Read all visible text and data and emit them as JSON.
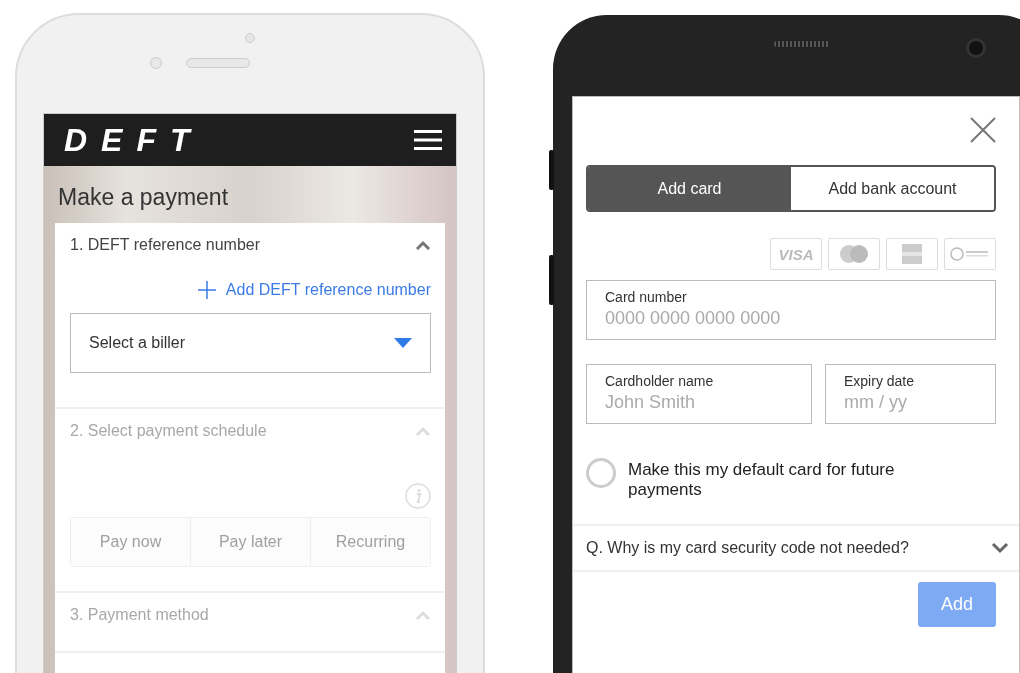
{
  "left_phone": {
    "app_bar": {
      "logo": "DEFT"
    },
    "title": "Make a payment",
    "sections": [
      {
        "kind": "biller",
        "heading": "1. DEFT reference number",
        "expanded": true,
        "disabled": false,
        "add_link": "Add DEFT reference number",
        "biller_select": {
          "label": "Select a biller"
        }
      },
      {
        "kind": "schedule",
        "heading": "2. Select payment schedule",
        "expanded": true,
        "disabled": true,
        "options": [
          {
            "label": "Pay now",
            "selected": false
          },
          {
            "label": "Pay later",
            "selected": false
          },
          {
            "label": "Recurring",
            "selected": false
          }
        ]
      },
      {
        "kind": "method",
        "heading": "3. Payment method",
        "expanded": true,
        "disabled": true
      }
    ]
  },
  "right_phone": {
    "tabs": [
      {
        "label": "Add card",
        "selected": true
      },
      {
        "label": "Add bank account",
        "selected": false
      }
    ],
    "card_logos": [
      {
        "kind": "visa",
        "text": "VISA"
      },
      {
        "kind": "mastercard"
      },
      {
        "kind": "amex"
      },
      {
        "kind": "diners"
      }
    ],
    "fields": [
      {
        "label": "Card number",
        "placeholder": "0000 0000 0000 0000"
      },
      {
        "label": "Cardholder name",
        "placeholder": "John Smith"
      },
      {
        "label": "Expiry date",
        "placeholder": "mm / yy"
      }
    ],
    "default_card": {
      "label": "Make this my default card for future payments",
      "checked": false
    },
    "faq": {
      "question": "Q. Why is my card security code not needed?",
      "expanded": false
    },
    "add_button": {
      "label": "Add",
      "disabled": true
    }
  }
}
